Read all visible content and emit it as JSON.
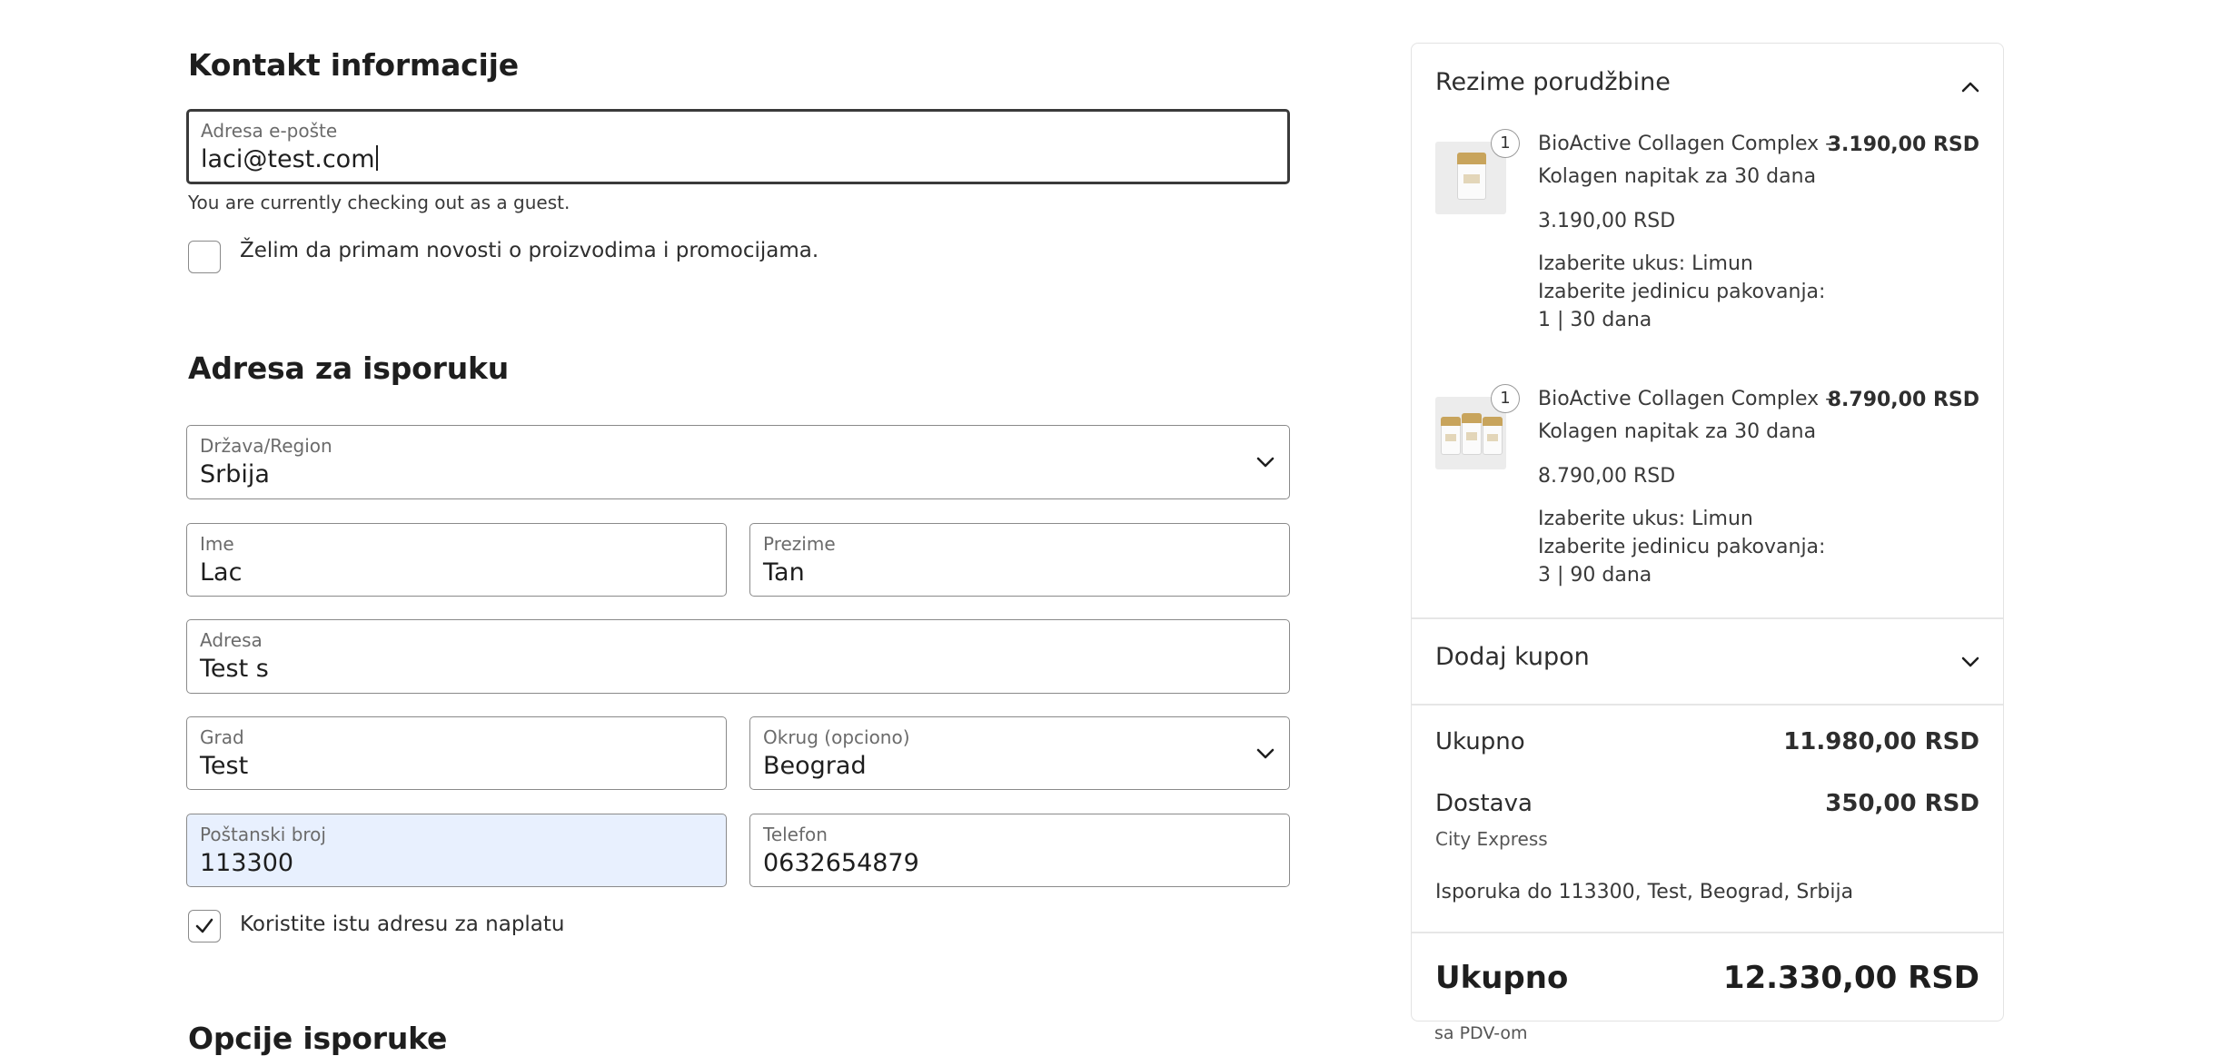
{
  "contact": {
    "title": "Kontakt informacije",
    "email_label": "Adresa e-pošte",
    "email_value": "laci@test.com",
    "guest_note": "You are currently checking out as a guest.",
    "newsletter_label": "Želim da primam novosti o proizvodima i promocijama.",
    "newsletter_checked": false
  },
  "shipping": {
    "title": "Adresa za isporuku",
    "country_label": "Država/Region",
    "country_value": "Srbija",
    "first_name_label": "Ime",
    "first_name_value": "Lac",
    "last_name_label": "Prezime",
    "last_name_value": "Tan",
    "address_label": "Adresa",
    "address_value": "Test s",
    "city_label": "Grad",
    "city_value": "Test",
    "district_label": "Okrug (opciono)",
    "district_value": "Beograd",
    "postal_label": "Poštanski broj",
    "postal_value": "113300",
    "phone_label": "Telefon",
    "phone_value": "0632654879",
    "same_billing_label": "Koristite istu adresu za naplatu",
    "same_billing_checked": true
  },
  "delivery_options": {
    "title": "Opcije isporuke"
  },
  "summary": {
    "title": "Rezime porudžbine",
    "items": [
      {
        "quantity": "1",
        "name": "BioActive Collagen Complex – Kolagen napitak za 30 dana",
        "total": "3.190,00 RSD",
        "unit_price": "3.190,00 RSD",
        "option_flavor": "Izaberite ukus: Limun",
        "option_pack_label": "Izaberite jedinicu pakovanja:",
        "option_pack_value": "1 | 30 dana"
      },
      {
        "quantity": "1",
        "name": "BioActive Collagen Complex – Kolagen napitak za 30 dana",
        "total": "8.790,00 RSD",
        "unit_price": "8.790,00 RSD",
        "option_flavor": "Izaberite ukus: Limun",
        "option_pack_label": "Izaberite jedinicu pakovanja:",
        "option_pack_value": "3 | 90 dana"
      }
    ],
    "coupon_label": "Dodaj kupon",
    "subtotal_label": "Ukupno",
    "subtotal_value": "11.980,00 RSD",
    "shipping_label": "Dostava",
    "shipping_value": "350,00 RSD",
    "shipping_method": "City Express",
    "delivery_address": "Isporuka do 113300, Test, Beograd, Srbija",
    "grand_total_label": "Ukupno",
    "grand_total_value": "12.330,00 RSD",
    "vat_note": "sa PDV-om"
  },
  "icons": {
    "collapse": "chevron-up-icon",
    "expand": "chevron-down-icon",
    "check": "check-icon"
  }
}
